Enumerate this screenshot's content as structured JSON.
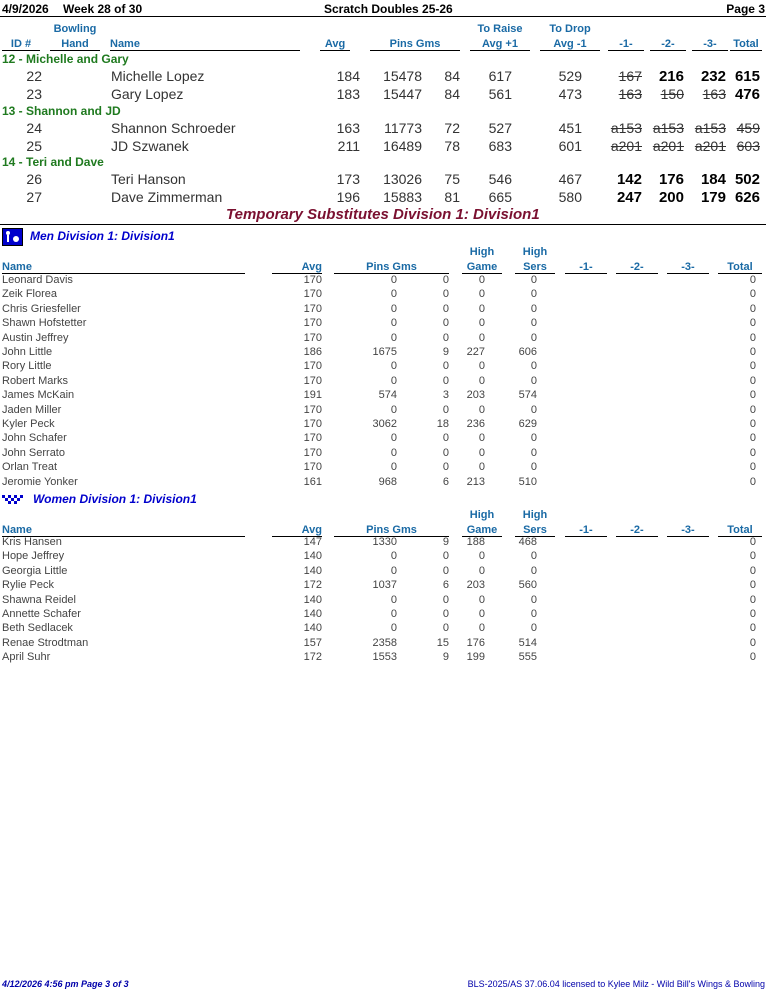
{
  "header": {
    "date": "4/9/2026",
    "week": "Week 28 of 30",
    "title": "Scratch Doubles 25-26",
    "page": "Page 3"
  },
  "columns": {
    "id": "ID #",
    "bowling1": "Bowling",
    "hand": "Hand",
    "name": "Name",
    "avg": "Avg",
    "pins_gms": "Pins  Gms",
    "raise1": "To Raise",
    "raise2": "Avg +1",
    "drop1": "To Drop",
    "drop2": "Avg -1",
    "g1": "-1-",
    "g2": "-2-",
    "g3": "-3-",
    "total": "Total"
  },
  "teams": [
    {
      "label": "12 - Michelle and Gary",
      "bowlers": [
        {
          "id": "22",
          "name": "Michelle Lopez",
          "avg": "184",
          "pins": "15478",
          "gms": "84",
          "raise": "617",
          "drop": "529",
          "g1": "167",
          "g2": "216",
          "g3": "232",
          "total": "615",
          "s1": true,
          "s2": false,
          "s3": false,
          "st": false
        },
        {
          "id": "23",
          "name": "Gary Lopez",
          "avg": "183",
          "pins": "15447",
          "gms": "84",
          "raise": "561",
          "drop": "473",
          "g1": "163",
          "g2": "150",
          "g3": "163",
          "total": "476",
          "s1": true,
          "s2": true,
          "s3": true,
          "st": false
        }
      ]
    },
    {
      "label": "13 - Shannon and JD",
      "bowlers": [
        {
          "id": "24",
          "name": "Shannon Schroeder",
          "avg": "163",
          "pins": "11773",
          "gms": "72",
          "raise": "527",
          "drop": "451",
          "g1": "a153",
          "g2": "a153",
          "g3": "a153",
          "total": "459",
          "s1": true,
          "s2": true,
          "s3": true,
          "st": true
        },
        {
          "id": "25",
          "name": "JD Szwanek",
          "avg": "211",
          "pins": "16489",
          "gms": "78",
          "raise": "683",
          "drop": "601",
          "g1": "a201",
          "g2": "a201",
          "g3": "a201",
          "total": "603",
          "s1": true,
          "s2": true,
          "s3": true,
          "st": true
        }
      ]
    },
    {
      "label": "14 - Teri and Dave",
      "bowlers": [
        {
          "id": "26",
          "name": "Teri Hanson",
          "avg": "173",
          "pins": "13026",
          "gms": "75",
          "raise": "546",
          "drop": "467",
          "g1": "142",
          "g2": "176",
          "g3": "184",
          "total": "502",
          "s1": false,
          "s2": false,
          "s3": false,
          "st": false
        },
        {
          "id": "27",
          "name": "Dave Zimmerman",
          "avg": "196",
          "pins": "15883",
          "gms": "81",
          "raise": "665",
          "drop": "580",
          "g1": "247",
          "g2": "200",
          "g3": "179",
          "total": "626",
          "s1": false,
          "s2": false,
          "s3": false,
          "st": false
        }
      ]
    }
  ],
  "subs_title": "Temporary Substitutes   Division 1: Division1",
  "sub_columns": {
    "name": "Name",
    "avg": "Avg",
    "pins_gms": "Pins  Gms",
    "high": "High",
    "game": "Game",
    "sers": "Sers",
    "g1": "-1-",
    "g2": "-2-",
    "g3": "-3-",
    "total": "Total"
  },
  "men": {
    "title": "Men   Division 1: Division1",
    "rows": [
      [
        "Leonard Davis",
        "170",
        "0",
        "0",
        "0",
        "0",
        "0"
      ],
      [
        "Zeik Florea",
        "170",
        "0",
        "0",
        "0",
        "0",
        "0"
      ],
      [
        "Chris Griesfeller",
        "170",
        "0",
        "0",
        "0",
        "0",
        "0"
      ],
      [
        "Shawn Hofstetter",
        "170",
        "0",
        "0",
        "0",
        "0",
        "0"
      ],
      [
        "Austin Jeffrey",
        "170",
        "0",
        "0",
        "0",
        "0",
        "0"
      ],
      [
        "John Little",
        "186",
        "1675",
        "9",
        "227",
        "606",
        "0"
      ],
      [
        "Rory Little",
        "170",
        "0",
        "0",
        "0",
        "0",
        "0"
      ],
      [
        "Robert Marks",
        "170",
        "0",
        "0",
        "0",
        "0",
        "0"
      ],
      [
        "James McKain",
        "191",
        "574",
        "3",
        "203",
        "574",
        "0"
      ],
      [
        "Jaden Miller",
        "170",
        "0",
        "0",
        "0",
        "0",
        "0"
      ],
      [
        "Kyler Peck",
        "170",
        "3062",
        "18",
        "236",
        "629",
        "0"
      ],
      [
        "John Schafer",
        "170",
        "0",
        "0",
        "0",
        "0",
        "0"
      ],
      [
        "John Serrato",
        "170",
        "0",
        "0",
        "0",
        "0",
        "0"
      ],
      [
        "Orlan Treat",
        "170",
        "0",
        "0",
        "0",
        "0",
        "0"
      ],
      [
        "Jeromie Yonker",
        "161",
        "968",
        "6",
        "213",
        "510",
        "0"
      ]
    ]
  },
  "women": {
    "title": "Women   Division 1: Division1",
    "rows": [
      [
        "Kris Hansen",
        "147",
        "1330",
        "9",
        "188",
        "468",
        "0"
      ],
      [
        "Hope Jeffrey",
        "140",
        "0",
        "0",
        "0",
        "0",
        "0"
      ],
      [
        "Georgia Little",
        "140",
        "0",
        "0",
        "0",
        "0",
        "0"
      ],
      [
        "Rylie Peck",
        "172",
        "1037",
        "6",
        "203",
        "560",
        "0"
      ],
      [
        "Shawna Reidel",
        "140",
        "0",
        "0",
        "0",
        "0",
        "0"
      ],
      [
        "Annette Schafer",
        "140",
        "0",
        "0",
        "0",
        "0",
        "0"
      ],
      [
        "Beth Sedlacek",
        "140",
        "0",
        "0",
        "0",
        "0",
        "0"
      ],
      [
        "Renae Strodtman",
        "157",
        "2358",
        "15",
        "176",
        "514",
        "0"
      ],
      [
        "April Suhr",
        "172",
        "1553",
        "9",
        "199",
        "555",
        "0"
      ]
    ]
  },
  "footer": {
    "left": "4/12/2026  4:56 pm  Page 3 of 3",
    "right": "BLS-2025/AS 37.06.04 licensed to Kylee Milz - Wild Bill's Wings & Bowling"
  }
}
